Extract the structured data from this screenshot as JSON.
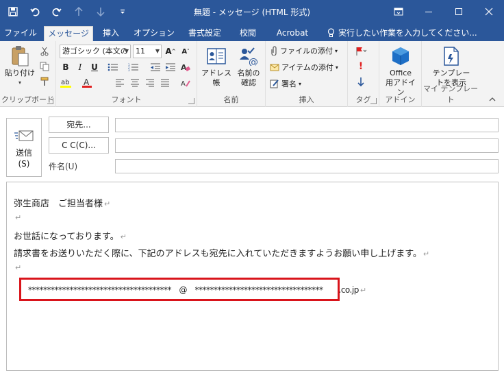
{
  "window": {
    "title": "無題 - メッセージ (HTML 形式)"
  },
  "tabs": [
    {
      "label": "ファイル"
    },
    {
      "label": "メッセージ"
    },
    {
      "label": "挿入"
    },
    {
      "label": "オプション"
    },
    {
      "label": "書式設定"
    },
    {
      "label": "校閲"
    },
    {
      "label": "Acrobat"
    }
  ],
  "tell_me": "実行したい作業を入力してください...",
  "ribbon": {
    "clipboard": {
      "paste": "貼り付け",
      "label": "クリップボード"
    },
    "font": {
      "font_name": "游ゴシック (本文の",
      "font_size": "11",
      "label": "フォント"
    },
    "names": {
      "address_book": "アドレス帳",
      "check_names_1": "名前の",
      "check_names_2": "確認",
      "label": "名前"
    },
    "include": {
      "attach_file": "ファイルの添付",
      "attach_item": "アイテムの添付",
      "signature": "署名",
      "label": "挿入"
    },
    "tags": {
      "label": "タグ"
    },
    "addins": {
      "office_1": "Office",
      "office_2": "用アドイン",
      "label": "アドイン"
    },
    "templates": {
      "view_1": "テンプレー",
      "view_2": "トを表示",
      "label": "マイ テンプレート"
    }
  },
  "compose": {
    "send_1": "送信",
    "send_2": "(S)",
    "to_button": "宛先...",
    "cc_button": "C C(C)...",
    "subject_label": "件名(U)",
    "to_value": "",
    "cc_value": "",
    "subject_value": ""
  },
  "body": {
    "line1": "弥生商店　ご担当者様",
    "line3": "お世話になっております。",
    "line4": "請求書をお送りいただく際に、下記のアドレスも宛先に入れていただきますようお願い申し上げます。",
    "address": "**************************************　@　**********************************　　.co.jp"
  },
  "colors": {
    "titlebar": "#2b579a",
    "ribbon": "#f3f3f3",
    "highlight_box": "#d9141b"
  }
}
